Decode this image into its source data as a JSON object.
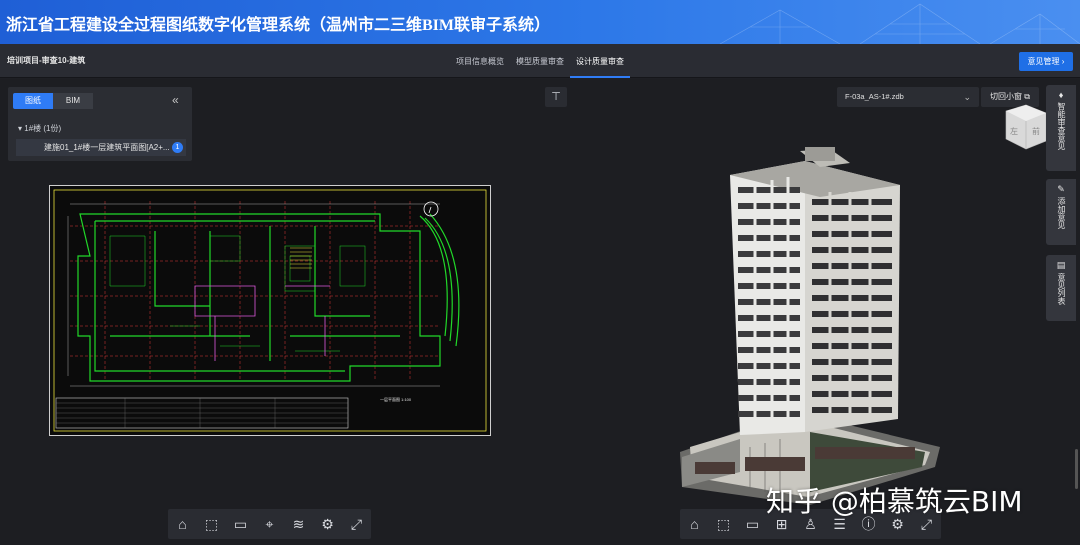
{
  "header": {
    "title": "浙江省工程建设全过程图纸数字化管理系统（温州市二三维BIM联审子系统）"
  },
  "nav": {
    "project": "培训项目-审查10-建筑",
    "tabs": [
      {
        "label": "项目信息概览"
      },
      {
        "label": "模型质量审查"
      },
      {
        "label": "设计质量审查"
      }
    ],
    "opinion_button": "意见管理 ›"
  },
  "left_panel": {
    "toggle": [
      {
        "label": "图纸"
      },
      {
        "label": "BIM"
      }
    ],
    "collapse_icon": "«",
    "tree_group": "▾  1#楼 (1份)",
    "tree_item": "建施01_1#楼一层建筑平面图[A2+...",
    "tree_item_count": "1"
  },
  "right_panel": {
    "file_select": "F-03a_AS-1#.zdb",
    "switch_button": "切回小窗",
    "cube_labels": {
      "left": "左",
      "front": "前"
    },
    "side_buttons": [
      {
        "icon": "bulb-icon",
        "label": "智能审查意见"
      },
      {
        "icon": "pencil-icon",
        "label": "添加意见"
      },
      {
        "icon": "list-icon",
        "label": "意见列表"
      }
    ]
  },
  "drawing": {
    "caption": "一层平面图 1:100"
  },
  "toolbars": {
    "left": [
      "home-icon",
      "zoom-area-icon",
      "ruler-icon",
      "locate-icon",
      "layers-icon",
      "gear-icon",
      "fullscreen-icon"
    ],
    "right": [
      "home-icon",
      "zoom-area-icon",
      "ruler-icon",
      "section-icon",
      "person-icon",
      "properties-icon",
      "info-icon",
      "gear-icon",
      "fullscreen-icon"
    ]
  },
  "watermark": "知乎 @柏慕筑云BIM",
  "colors": {
    "accent": "#2f7cf6",
    "banner": "#2d78e8",
    "cad_green": "#21d829",
    "cad_red": "#e23a3a",
    "cad_magenta": "#e05ae0",
    "cad_yellow": "#e8e23a"
  }
}
